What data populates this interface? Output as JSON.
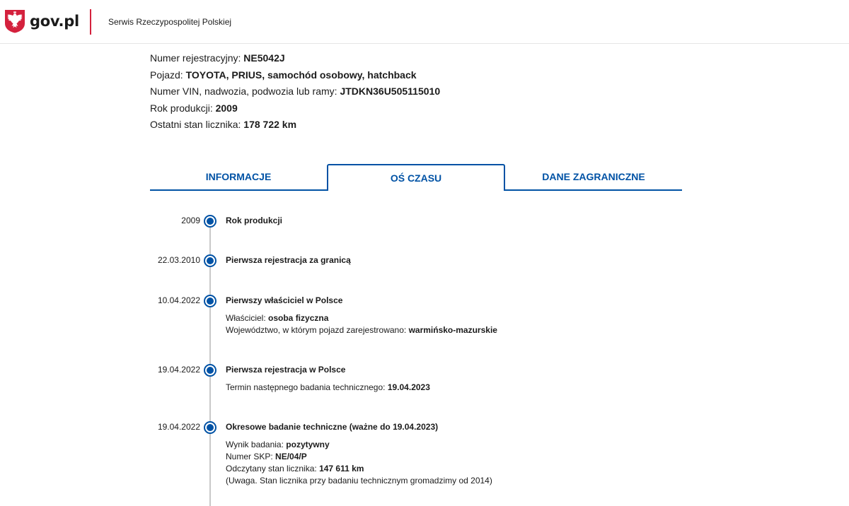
{
  "header": {
    "logo_text": "gov.pl",
    "service_name": "Serwis Rzeczypospolitej Polskiej",
    "brand_color": "#d4213d"
  },
  "vehicle": [
    {
      "label": "Numer rejestracyjny: ",
      "value": "NE5042J"
    },
    {
      "label": "Pojazd: ",
      "value": "TOYOTA, PRIUS, samochód osobowy, hatchback"
    },
    {
      "label": "Numer VIN, nadwozia, podwozia lub ramy: ",
      "value": "JTDKN36U505115010"
    },
    {
      "label": "Rok produkcji: ",
      "value": "2009"
    },
    {
      "label": "Ostatni stan licznika: ",
      "value": "178 722 km"
    }
  ],
  "tabs": [
    {
      "label": "INFORMACJE",
      "active": false
    },
    {
      "label": "OŚ CZASU",
      "active": true
    },
    {
      "label": "DANE ZAGRANICZNE",
      "active": false
    }
  ],
  "accent_color": "#0052a5",
  "timeline": [
    {
      "date": "2009",
      "title": "Rok produkcji",
      "details": []
    },
    {
      "date": "22.03.2010",
      "title": "Pierwsza rejestracja za granicą",
      "details": []
    },
    {
      "date": "10.04.2022",
      "title": "Pierwszy właściciel w Polsce",
      "details": [
        {
          "label": "Właściciel: ",
          "value": "osoba fizyczna"
        },
        {
          "label": "Województwo, w którym pojazd zarejestrowano: ",
          "value": "warmińsko-mazurskie"
        }
      ]
    },
    {
      "date": "19.04.2022",
      "title": "Pierwsza rejestracja w Polsce",
      "details": [
        {
          "label": "Termin następnego badania technicznego: ",
          "value": "19.04.2023"
        }
      ]
    },
    {
      "date": "19.04.2022",
      "title": "Okresowe badanie techniczne (ważne do 19.04.2023)",
      "details": [
        {
          "label": "Wynik badania: ",
          "value": "pozytywny"
        },
        {
          "label": "Numer SKP: ",
          "value": "NE/04/P"
        },
        {
          "label": "Odczytany stan licznika: ",
          "value": "147 611 km"
        },
        {
          "label": "(Uwaga. Stan licznika przy badaniu technicznym gromadzimy od 2014)",
          "value": ""
        }
      ]
    }
  ]
}
